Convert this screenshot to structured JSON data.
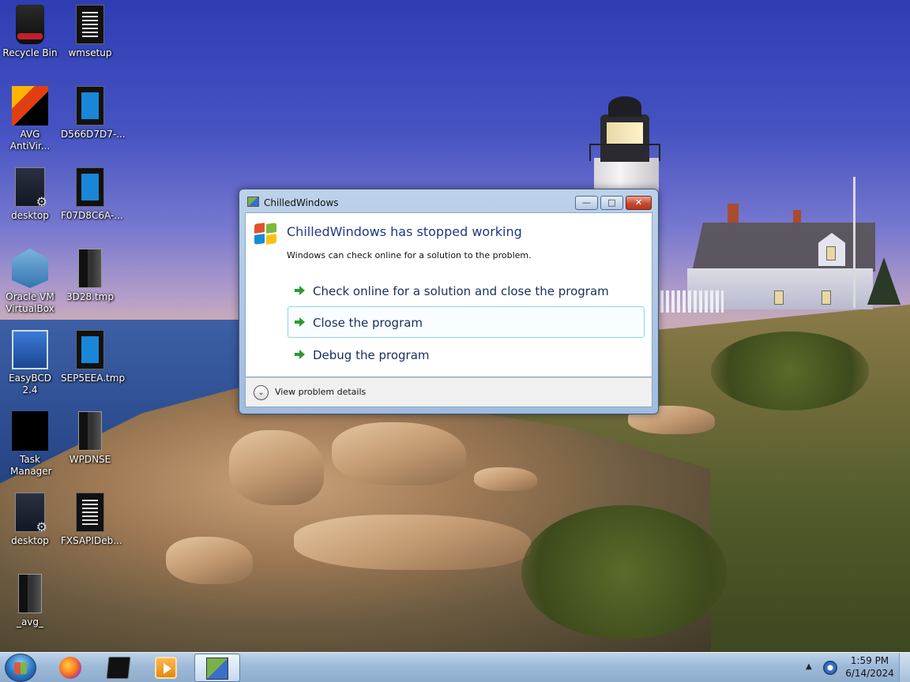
{
  "desktop": {
    "icons": [
      {
        "label": "Recycle Bin",
        "icon": "recycle-bin-icon"
      },
      {
        "label": "wmsetup",
        "icon": "document-icon"
      },
      {
        "label": "AVG AntiVir...",
        "icon": "avg-antivirus-icon"
      },
      {
        "label": "D566D7D7-...",
        "icon": "tmp-file-icon"
      },
      {
        "label": "desktop",
        "icon": "config-file-icon"
      },
      {
        "label": "F07D8C6A-...",
        "icon": "tmp-file-icon"
      },
      {
        "label": "Oracle VM VirtualBox",
        "icon": "virtualbox-icon"
      },
      {
        "label": "3D28.tmp",
        "icon": "folder-file-icon"
      },
      {
        "label": "EasyBCD 2.4",
        "icon": "easybcd-icon"
      },
      {
        "label": "SEP5EEA.tmp",
        "icon": "tmp-file-icon"
      },
      {
        "label": "Task Manager",
        "icon": "task-manager-icon"
      },
      {
        "label": "WPDNSE",
        "icon": "folder-icon"
      },
      {
        "label": "desktop",
        "icon": "config-file-icon"
      },
      {
        "label": "FXSAPIDeb...",
        "icon": "document-icon"
      },
      {
        "label": "_avg_",
        "icon": "folder-icon"
      }
    ]
  },
  "dialog": {
    "title": "ChilledWindows",
    "heading": "ChilledWindows has stopped working",
    "subtext": "Windows can check online for a solution to the problem.",
    "options": [
      {
        "label": "Check online for a solution and close the program"
      },
      {
        "label": "Close the program",
        "selected": true
      },
      {
        "label": "Debug the program"
      }
    ],
    "details_label": "View problem details",
    "caption_buttons": {
      "minimize": "—",
      "maximize": "□",
      "close": "✕"
    }
  },
  "taskbar": {
    "items": [
      {
        "name": "firefox",
        "icon": "firefox-icon"
      },
      {
        "name": "command-prompt",
        "icon": "cmd-icon"
      },
      {
        "name": "media-player",
        "icon": "media-player-icon"
      },
      {
        "name": "chilledwindows",
        "icon": "app-icon",
        "active": true
      }
    ],
    "tray_arrow": "▲",
    "clock": {
      "time": "1:59 PM",
      "date": "6/14/2024"
    }
  }
}
